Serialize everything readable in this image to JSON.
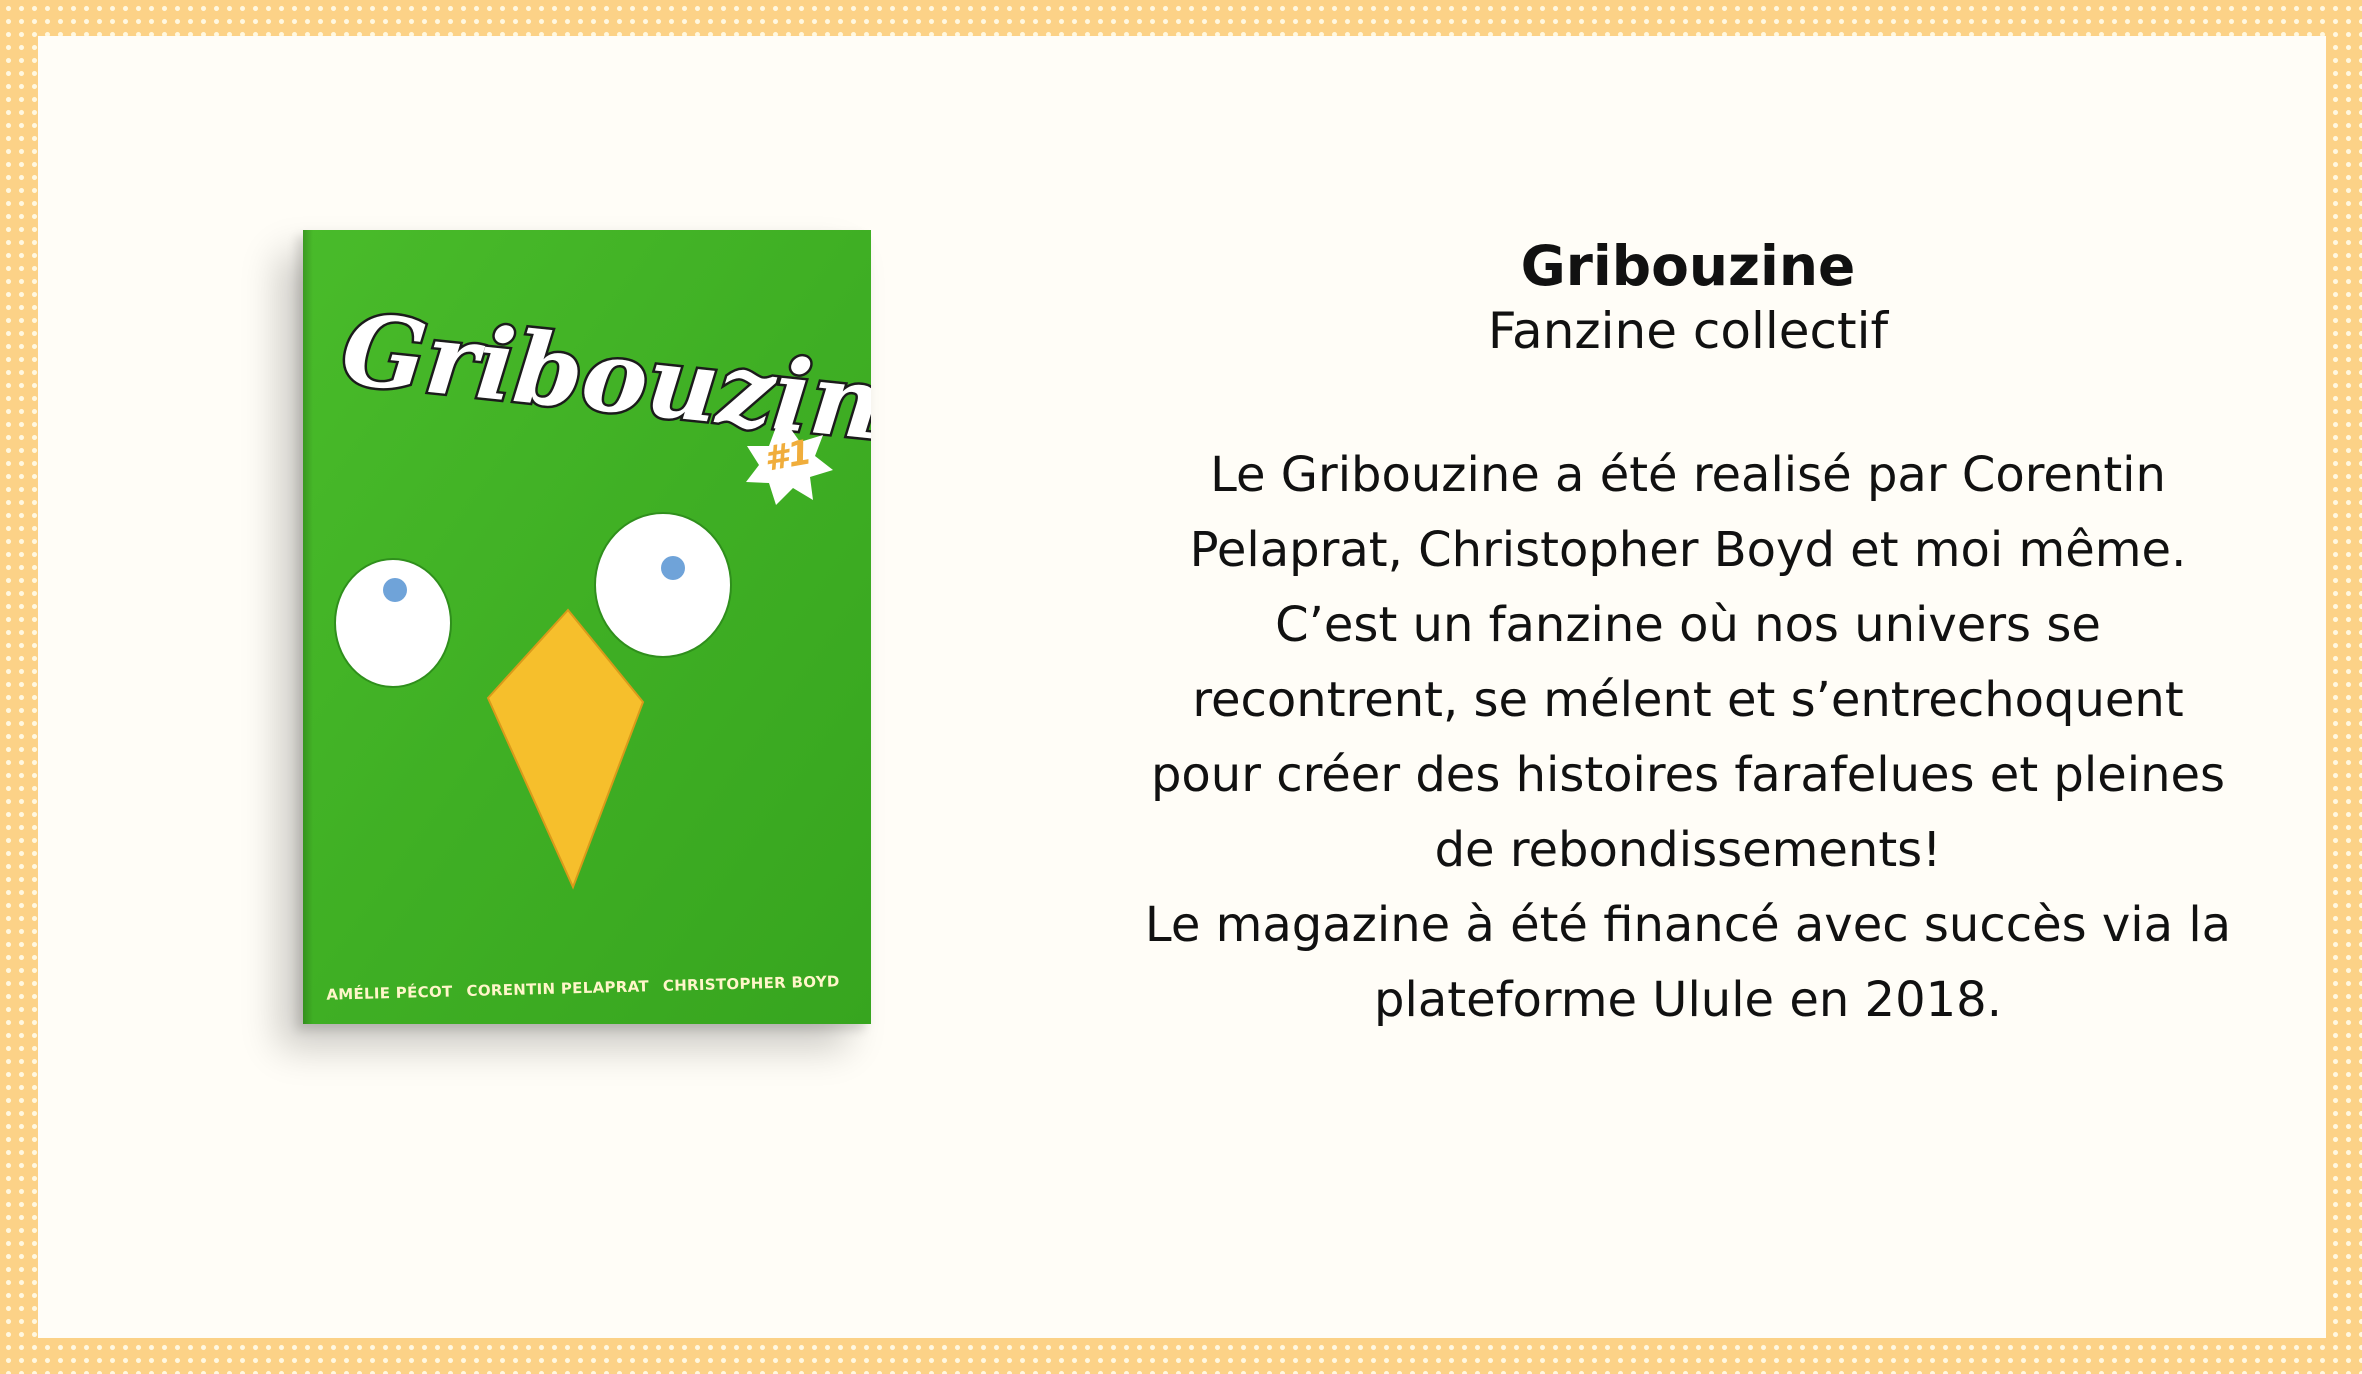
{
  "book": {
    "cover_title": "Gribouzine",
    "issue_badge": "#1",
    "authors": [
      "AMÉLIE PÉCOT",
      "CORENTIN PELAPRAT",
      "CHRISTOPHER BOYD"
    ],
    "colors": {
      "cover_green": "#3faf24",
      "beak_yellow": "#f6bf2c",
      "eye_pupil": "#6fa3d9",
      "border_orange": "#fcd287"
    }
  },
  "description": {
    "title": "Gribouzine",
    "subtitle": "Fanzine collectif",
    "lines": [
      "Le Gribouzine a été realisé par Corentin",
      "Pelaprat, Christopher Boyd et moi même.",
      "C’est un fanzine où nos univers se",
      "recontrent, se mélent et s’entrechoquent",
      "pour créer des histoires farafelues et pleines",
      "de rebondissements!",
      "Le magazine à été financé avec succès via la",
      "plateforme Ulule en 2018."
    ]
  }
}
